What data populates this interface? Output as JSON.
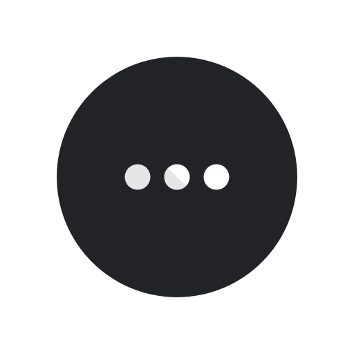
{
  "button": {
    "icon": "more-horizontal-icon",
    "background_color": "#222327",
    "dot_color": "#ffffff",
    "dot_shade_color": "#e6e6e6"
  }
}
